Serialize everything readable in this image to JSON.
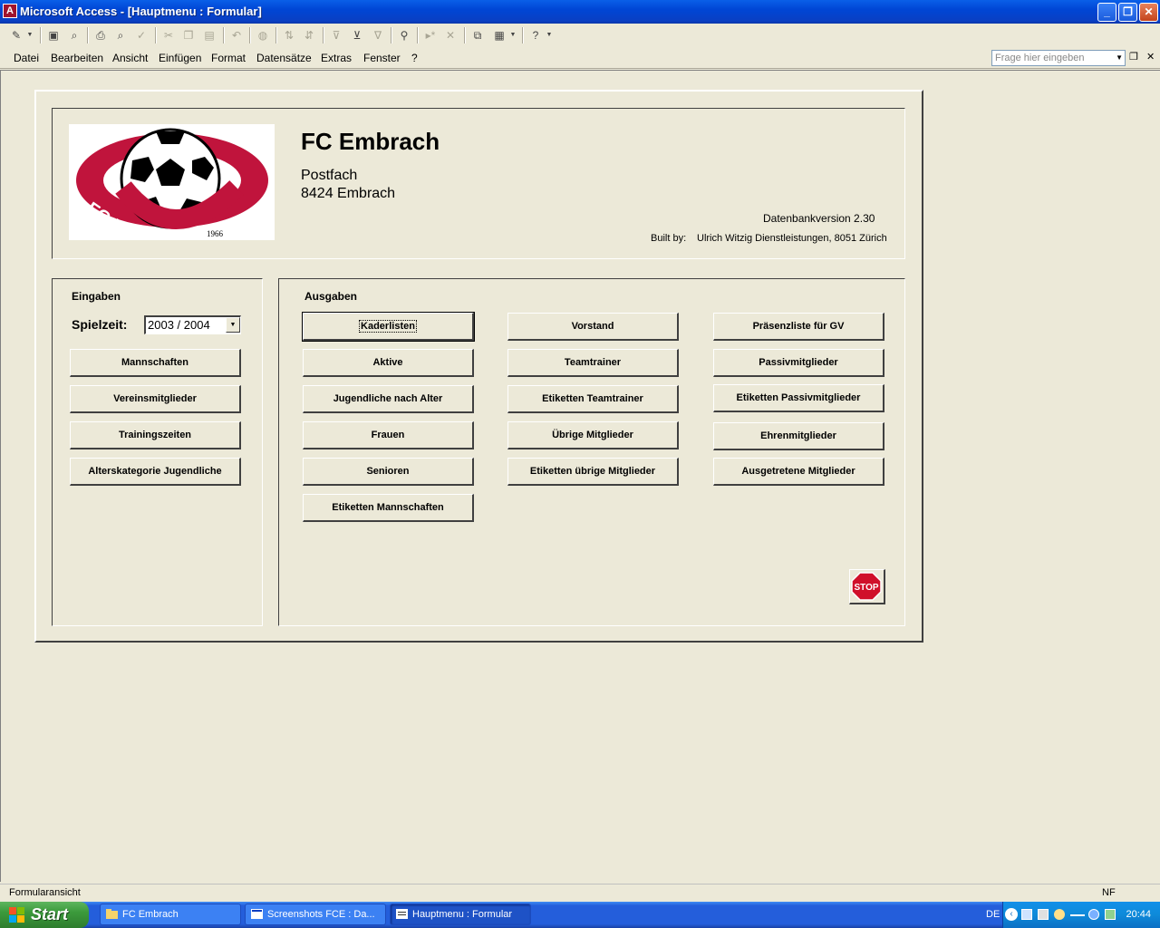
{
  "window": {
    "title": "Microsoft Access - [Hauptmenu : Formular]",
    "minimize_glyph": "_",
    "restore_glyph": "❐",
    "close_glyph": "✕",
    "app_icon_letter": "A"
  },
  "toolbar": {
    "icons": [
      "design-view-icon",
      "save-icon",
      "search-file-icon",
      "print-icon",
      "print-preview-icon",
      "spelling-icon",
      "cut-icon",
      "copy-icon",
      "paste-icon",
      "undo-icon",
      "hyperlink-icon",
      "sort-ascending-icon",
      "sort-descending-icon",
      "filter-by-selection-icon",
      "filter-by-form-icon",
      "apply-filter-icon",
      "find-icon",
      "new-record-icon",
      "delete-record-icon",
      "database-window-icon",
      "new-object-icon",
      "help-icon"
    ]
  },
  "menu": {
    "items": [
      "Datei",
      "Bearbeiten",
      "Ansicht",
      "Einfügen",
      "Format",
      "Datensätze",
      "Extras",
      "Fenster",
      "?"
    ],
    "help_placeholder": "Frage hier eingeben"
  },
  "header": {
    "club_name": "FC Embrach",
    "address_line1": "Postfach",
    "address_line2": "8424 Embrach",
    "version": "Datenbankversion 2.30",
    "built_by_label": "Built by:",
    "built_by_value": "Ulrich Witzig Dienstleistungen, 8051 Zürich",
    "logo_text": "FC EMBRACH",
    "logo_year": "1966"
  },
  "eingaben": {
    "title": "Eingaben",
    "season_label": "Spielzeit:",
    "season_value": "2003 / 2004",
    "buttons": [
      "Mannschaften",
      "Vereinsmitglieder",
      "Trainingszeiten",
      "Alterskategorie Jugendliche"
    ]
  },
  "ausgaben": {
    "title": "Ausgaben",
    "col1": [
      "Kaderlisten",
      "Aktive",
      "Jugendliche nach Alter",
      "Frauen",
      "Senioren",
      "Etiketten Mannschaften"
    ],
    "col2": [
      "Vorstand",
      "Teamtrainer",
      "Etiketten Teamtrainer",
      "Übrige Mitglieder",
      "Etiketten übrige Mitglieder"
    ],
    "col3": [
      "Präsenzliste für GV",
      "Passivmitglieder",
      "Etiketten Passivmitglieder",
      "Ehrenmitglieder",
      "Ausgetretene Mitglieder"
    ],
    "stop_label": "STOP"
  },
  "status": {
    "left": "Formularansicht",
    "right": "NF"
  },
  "taskbar": {
    "start": "Start",
    "tasks": [
      "FC Embrach",
      "Screenshots FCE : Da...",
      "Hauptmenu : Formular"
    ],
    "lang": "DE",
    "clock": "20:44"
  },
  "colors": {
    "logo_red": "#c0143c",
    "stop_red": "#d0102a",
    "titlebar_blue": "#0a3fc2",
    "background": "#ece9d8"
  }
}
